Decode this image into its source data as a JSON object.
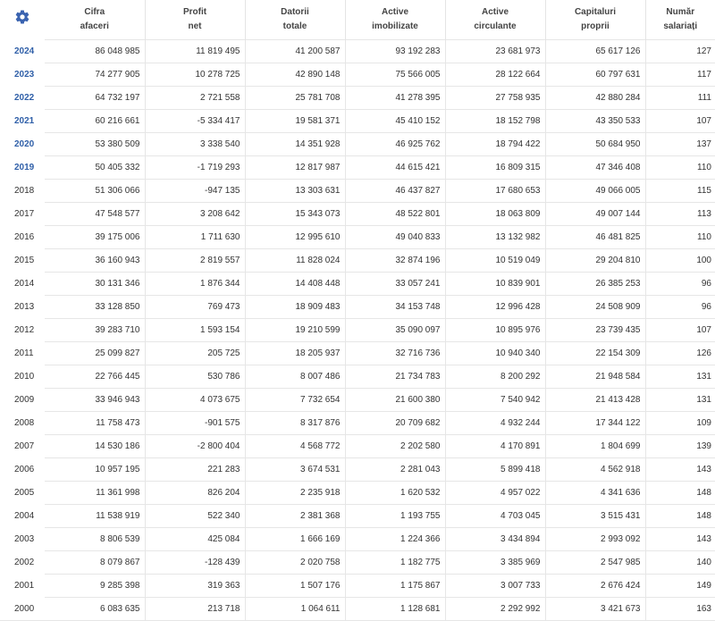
{
  "icons": {
    "settings": "gear-icon"
  },
  "colors": {
    "accent": "#2f5fa8",
    "gear": "#3a63b0"
  },
  "headers": [
    [
      "Cifra",
      "afaceri"
    ],
    [
      "Profit",
      "net"
    ],
    [
      "Datorii",
      "totale"
    ],
    [
      "Active",
      "imobilizate"
    ],
    [
      "Active",
      "circulante"
    ],
    [
      "Capitaluri",
      "proprii"
    ],
    [
      "Număr",
      "salariați"
    ]
  ],
  "rows": [
    {
      "year": "2024",
      "linked": true,
      "values": [
        "86 048 985",
        "11 819 495",
        "41 200 587",
        "93 192 283",
        "23 681 973",
        "65 617 126",
        "127"
      ]
    },
    {
      "year": "2023",
      "linked": true,
      "values": [
        "74 277 905",
        "10 278 725",
        "42 890 148",
        "75 566 005",
        "28 122 664",
        "60 797 631",
        "117"
      ]
    },
    {
      "year": "2022",
      "linked": true,
      "values": [
        "64 732 197",
        "2 721 558",
        "25 781 708",
        "41 278 395",
        "27 758 935",
        "42 880 284",
        "111"
      ]
    },
    {
      "year": "2021",
      "linked": true,
      "values": [
        "60 216 661",
        "-5 334 417",
        "19 581 371",
        "45 410 152",
        "18 152 798",
        "43 350 533",
        "107"
      ]
    },
    {
      "year": "2020",
      "linked": true,
      "values": [
        "53 380 509",
        "3 338 540",
        "14 351 928",
        "46 925 762",
        "18 794 422",
        "50 684 950",
        "137"
      ]
    },
    {
      "year": "2019",
      "linked": true,
      "values": [
        "50 405 332",
        "-1 719 293",
        "12 817 987",
        "44 615 421",
        "16 809 315",
        "47 346 408",
        "110"
      ]
    },
    {
      "year": "2018",
      "linked": false,
      "values": [
        "51 306 066",
        "-947 135",
        "13 303 631",
        "46 437 827",
        "17 680 653",
        "49 066 005",
        "115"
      ]
    },
    {
      "year": "2017",
      "linked": false,
      "values": [
        "47 548 577",
        "3 208 642",
        "15 343 073",
        "48 522 801",
        "18 063 809",
        "49 007 144",
        "113"
      ]
    },
    {
      "year": "2016",
      "linked": false,
      "values": [
        "39 175 006",
        "1 711 630",
        "12 995 610",
        "49 040 833",
        "13 132 982",
        "46 481 825",
        "110"
      ]
    },
    {
      "year": "2015",
      "linked": false,
      "values": [
        "36 160 943",
        "2 819 557",
        "11 828 024",
        "32 874 196",
        "10 519 049",
        "29 204 810",
        "100"
      ]
    },
    {
      "year": "2014",
      "linked": false,
      "values": [
        "30 131 346",
        "1 876 344",
        "14 408 448",
        "33 057 241",
        "10 839 901",
        "26 385 253",
        "96"
      ]
    },
    {
      "year": "2013",
      "linked": false,
      "values": [
        "33 128 850",
        "769 473",
        "18 909 483",
        "34 153 748",
        "12 996 428",
        "24 508 909",
        "96"
      ]
    },
    {
      "year": "2012",
      "linked": false,
      "values": [
        "39 283 710",
        "1 593 154",
        "19 210 599",
        "35 090 097",
        "10 895 976",
        "23 739 435",
        "107"
      ]
    },
    {
      "year": "2011",
      "linked": false,
      "values": [
        "25 099 827",
        "205 725",
        "18 205 937",
        "32 716 736",
        "10 940 340",
        "22 154 309",
        "126"
      ]
    },
    {
      "year": "2010",
      "linked": false,
      "values": [
        "22 766 445",
        "530 786",
        "8 007 486",
        "21 734 783",
        "8 200 292",
        "21 948 584",
        "131"
      ]
    },
    {
      "year": "2009",
      "linked": false,
      "values": [
        "33 946 943",
        "4 073 675",
        "7 732 654",
        "21 600 380",
        "7 540 942",
        "21 413 428",
        "131"
      ]
    },
    {
      "year": "2008",
      "linked": false,
      "values": [
        "11 758 473",
        "-901 575",
        "8 317 876",
        "20 709 682",
        "4 932 244",
        "17 344 122",
        "109"
      ]
    },
    {
      "year": "2007",
      "linked": false,
      "values": [
        "14 530 186",
        "-2 800 404",
        "4 568 772",
        "2 202 580",
        "4 170 891",
        "1 804 699",
        "139"
      ]
    },
    {
      "year": "2006",
      "linked": false,
      "values": [
        "10 957 195",
        "221 283",
        "3 674 531",
        "2 281 043",
        "5 899 418",
        "4 562 918",
        "143"
      ]
    },
    {
      "year": "2005",
      "linked": false,
      "values": [
        "11 361 998",
        "826 204",
        "2 235 918",
        "1 620 532",
        "4 957 022",
        "4 341 636",
        "148"
      ]
    },
    {
      "year": "2004",
      "linked": false,
      "values": [
        "11 538 919",
        "522 340",
        "2 381 368",
        "1 193 755",
        "4 703 045",
        "3 515 431",
        "148"
      ]
    },
    {
      "year": "2003",
      "linked": false,
      "values": [
        "8 806 539",
        "425 084",
        "1 666 169",
        "1 224 366",
        "3 434 894",
        "2 993 092",
        "143"
      ]
    },
    {
      "year": "2002",
      "linked": false,
      "values": [
        "8 079 867",
        "-128 439",
        "2 020 758",
        "1 182 775",
        "3 385 969",
        "2 547 985",
        "140"
      ]
    },
    {
      "year": "2001",
      "linked": false,
      "values": [
        "9 285 398",
        "319 363",
        "1 507 176",
        "1 175 867",
        "3 007 733",
        "2 676 424",
        "149"
      ]
    },
    {
      "year": "2000",
      "linked": false,
      "values": [
        "6 083 635",
        "213 718",
        "1 064 611",
        "1 128 681",
        "2 292 992",
        "3 421 673",
        "163"
      ]
    }
  ]
}
